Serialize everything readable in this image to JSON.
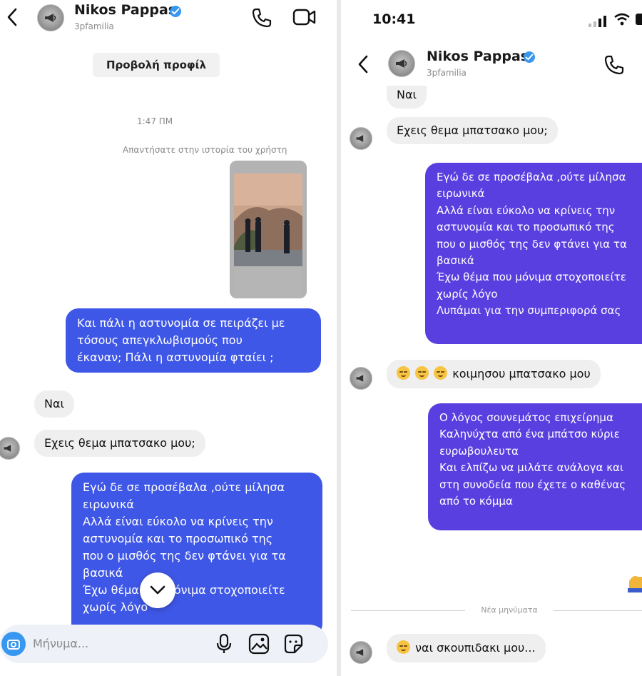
{
  "left": {
    "header": {
      "name": "Nikos Pappas",
      "handle": "3pfamilia"
    },
    "view_profile_label": "Προβολή προφίλ",
    "timestamp": "1:47 ΠΜ",
    "reply_note": "Απαντήσατε στην ιστορία του χρήστη",
    "messages": {
      "out1": "Και πάλι η αστυνομία σε πειράζει με\nτόσους απεγκλωβισμούς που\nέκαναν; Πάλι η αστυνομία φταίει ;",
      "in_nai": "Ναι",
      "in_theme": "Εχεις θεμα μπατσακο μου;",
      "out2": "Εγώ δε σε προσέβαλα ,ούτε μίλησα\nειρωνικά\nΑλλά είναι εύκολο να κρίνεις την\nαστυνομία και το προσωπικό της\nπου ο μισθός της δεν φτάνει για τα\nβασικά\nΈχω θέμα που μόνιμα στοχοποιείτε\nχωρίς λόγο"
    },
    "composer_placeholder": "Μήνυμα..."
  },
  "right": {
    "status_time": "10:41",
    "header": {
      "name": "Nikos Pappas",
      "handle": "3pfamilia"
    },
    "messages": {
      "in_nai": "Ναι",
      "in_theme": "Εχεις θεμα μπατσακο μου;",
      "out1": "Εγώ δε σε προσέβαλα ,ούτε μίλησα\nειρωνικά\nΑλλά είναι εύκολο να κρίνεις την\nαστυνομία και το προσωπικό της\nπου ο μισθός της δεν φτάνει για τα\nβασικά\nΈχω θέμα που μόνιμα στοχοποιείτε\nχωρίς λόγο\nΛυπάμαι για την συμπεριφορά σας",
      "in_sleep": "κοιμησου μπατσακο μου",
      "out2": "Ο λόγος σουνεμάτος επιχείρημα\nΚαληνύχτα από ένα μπάτσο κύριε\nευρωβουλευτα\nΚαι ελπίζω να μιλάτε ανάλογα και\nστη συνοδεία που έχετε ο καθένας\nαπό το κόμμα",
      "in_trash": "ναι σκουπιδακι μου..."
    },
    "new_messages_label": "Νέα μηνύματα"
  }
}
